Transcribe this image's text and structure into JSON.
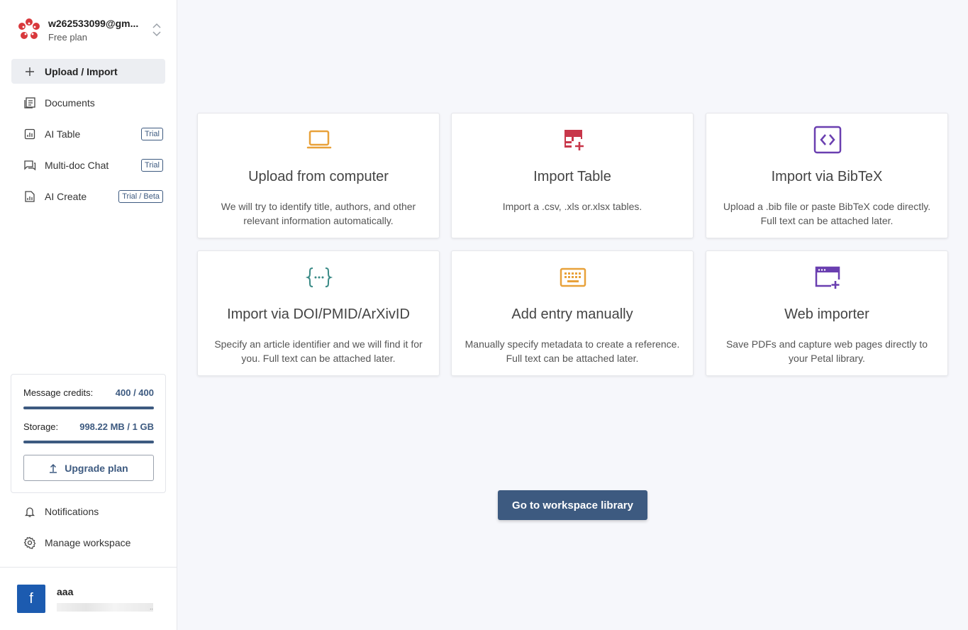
{
  "account": {
    "email": "w262533099@gm...",
    "plan": "Free plan"
  },
  "nav": [
    {
      "label": "Upload / Import",
      "icon": "plus-icon",
      "tag": ""
    },
    {
      "label": "Documents",
      "icon": "documents-icon",
      "tag": ""
    },
    {
      "label": "AI Table",
      "icon": "table-chart-icon",
      "tag": "Trial"
    },
    {
      "label": "Multi-doc Chat",
      "icon": "chat-icon",
      "tag": "Trial"
    },
    {
      "label": "AI Create",
      "icon": "doc-chart-icon",
      "tag": "Trial / Beta"
    }
  ],
  "usage": {
    "credits_label": "Message credits:",
    "credits_value": "400 / 400",
    "credits_fraction": 1.0,
    "storage_label": "Storage:",
    "storage_value": "998.22 MB / 1 GB",
    "storage_fraction": 0.998,
    "upgrade_label": "Upgrade plan"
  },
  "bottom_nav": [
    {
      "label": "Notifications",
      "icon": "bell-icon"
    },
    {
      "label": "Manage workspace",
      "icon": "gear-icon"
    }
  ],
  "user": {
    "avatar_letter": "f",
    "name": "aaa",
    "sub": ".."
  },
  "cards": [
    {
      "title": "Upload from computer",
      "desc": "We will try to identify title, authors, and other relevant information automatically.",
      "icon": "laptop-icon",
      "color": "#e8a13a"
    },
    {
      "title": "Import Table",
      "desc": "Import a .csv, .xls or.xlsx tables.",
      "icon": "table-plus-icon",
      "color": "#c8374a"
    },
    {
      "title": "Import via BibTeX",
      "desc": "Upload a .bib file or paste BibTeX code directly. Full text can be attached later.",
      "icon": "code-icon",
      "color": "#6a3fb0"
    },
    {
      "title": "Import via DOI/PMID/ArXivID",
      "desc": "Specify an article identifier and we will find it for you. Full text can be attached later.",
      "icon": "braces-icon",
      "color": "#3a8a86"
    },
    {
      "title": "Add entry manually",
      "desc": "Manually specify metadata to create a reference. Full text can be attached later.",
      "icon": "keyboard-icon",
      "color": "#e8a13a"
    },
    {
      "title": "Web importer",
      "desc": "Save PDFs and capture web pages directly to your Petal library.",
      "icon": "browser-plus-icon",
      "color": "#6a3fb0"
    }
  ],
  "go_button": "Go to workspace library"
}
